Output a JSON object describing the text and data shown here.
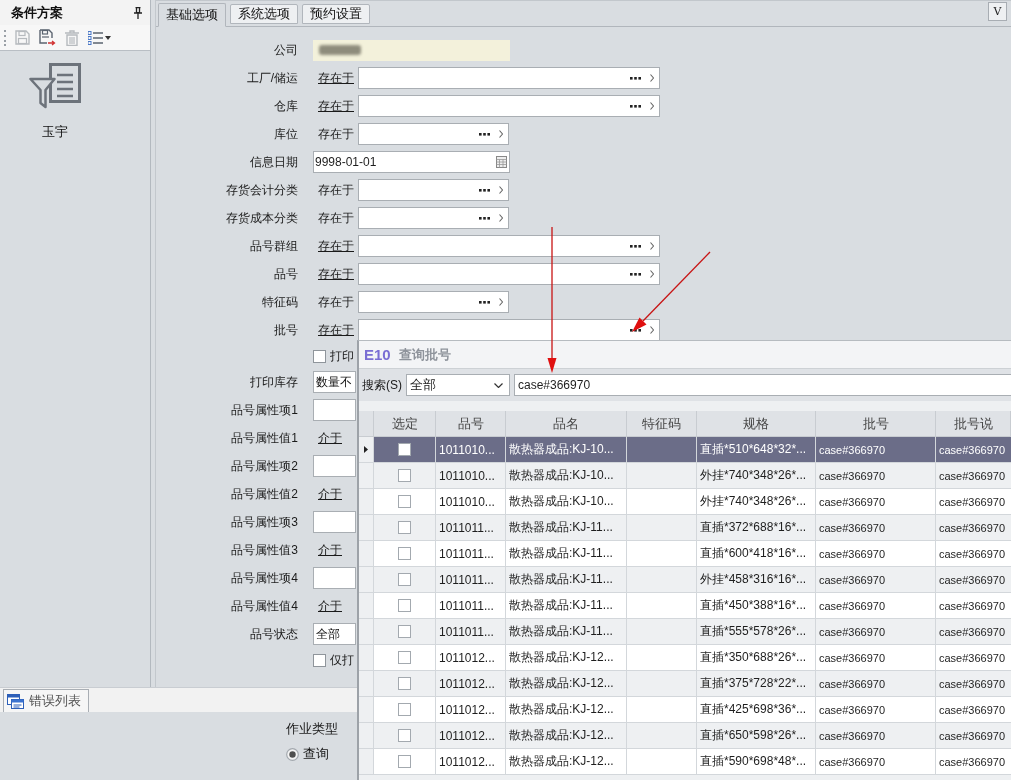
{
  "scheme_panel": {
    "title": "条件方案",
    "toolbar": [
      {
        "kind": "save",
        "disabled": true
      },
      {
        "kind": "save_as",
        "disabled": false
      },
      {
        "kind": "delete",
        "disabled": true
      },
      {
        "kind": "list_menu",
        "disabled": false
      }
    ],
    "schemes": [
      {
        "name": "玉宇"
      }
    ]
  },
  "tabs": [
    {
      "label": "基础选项",
      "selected": true
    },
    {
      "label": "系统选项",
      "selected": false
    },
    {
      "label": "预约设置",
      "selected": false
    }
  ],
  "corner_button": {
    "label": "V"
  },
  "form": {
    "rows": [
      {
        "kind": "redacted",
        "label": "公司"
      },
      {
        "kind": "lookup",
        "label": "工厂/储运",
        "operator": "存在于",
        "underlined": true,
        "wide": true
      },
      {
        "kind": "lookup",
        "label": "仓库",
        "operator": "存在于",
        "underlined": true,
        "wide": true
      },
      {
        "kind": "lookup",
        "label": "库位",
        "operator": "存在于",
        "underlined": false,
        "wide": false
      },
      {
        "kind": "date",
        "label": "信息日期",
        "value": "9998-01-01"
      },
      {
        "kind": "lookup",
        "label": "存货会计分类",
        "operator": "存在于",
        "underlined": false,
        "wide": false
      },
      {
        "kind": "lookup",
        "label": "存货成本分类",
        "operator": "存在于",
        "underlined": false,
        "wide": false
      },
      {
        "kind": "lookup",
        "label": "品号群组",
        "operator": "存在于",
        "underlined": true,
        "wide": true
      },
      {
        "kind": "lookup",
        "label": "品号",
        "operator": "存在于",
        "underlined": true,
        "wide": true
      },
      {
        "kind": "lookup",
        "label": "特征码",
        "operator": "存在于",
        "underlined": false,
        "wide": false
      },
      {
        "kind": "lookup",
        "label": "批号",
        "operator": "存在于",
        "underlined": true,
        "wide": true
      },
      {
        "kind": "checkbox",
        "text": "打印",
        "checked": false
      },
      {
        "kind": "select",
        "label": "打印库存",
        "value": "数量不"
      },
      {
        "kind": "input",
        "label": "品号属性项1"
      },
      {
        "kind": "operator",
        "label": "品号属性值1",
        "operator": "介于",
        "underlined": true
      },
      {
        "kind": "input",
        "label": "品号属性项2"
      },
      {
        "kind": "operator",
        "label": "品号属性值2",
        "operator": "介于",
        "underlined": true
      },
      {
        "kind": "input",
        "label": "品号属性项3"
      },
      {
        "kind": "operator",
        "label": "品号属性值3",
        "operator": "介于",
        "underlined": true
      },
      {
        "kind": "input",
        "label": "品号属性项4"
      },
      {
        "kind": "operator",
        "label": "品号属性值4",
        "operator": "介于",
        "underlined": true
      },
      {
        "kind": "select",
        "label": "品号状态",
        "value": "全部"
      },
      {
        "kind": "checkbox",
        "text": "仅打",
        "checked": false
      }
    ]
  },
  "error_tab": {
    "label": "错误列表"
  },
  "job_type": {
    "label": "作业类型",
    "options": [
      {
        "label": "查询",
        "selected": true
      }
    ]
  },
  "lookup_dialog": {
    "logo": "E10",
    "title": "查询批号",
    "search": {
      "label": "搜索(S)",
      "scope": "全部",
      "value": "case#366970"
    },
    "table": {
      "columns": [
        "选定",
        "品号",
        "品名",
        "特征码",
        "规格",
        "批号",
        "批号说"
      ],
      "rows": [
        {
          "selected": true,
          "checked": false,
          "item_no": "1011010...",
          "item_name": "散热器成品:KJ-10...",
          "spec": "直插*510*648*32*...",
          "batch": "case#366970",
          "batch_note": "case#366970"
        },
        {
          "selected": false,
          "checked": false,
          "item_no": "1011010...",
          "item_name": "散热器成品:KJ-10...",
          "spec": "外挂*740*348*26*...",
          "batch": "case#366970",
          "batch_note": "case#366970"
        },
        {
          "selected": false,
          "checked": false,
          "item_no": "1011010...",
          "item_name": "散热器成品:KJ-10...",
          "spec": "外挂*740*348*26*...",
          "batch": "case#366970",
          "batch_note": "case#366970"
        },
        {
          "selected": false,
          "checked": false,
          "item_no": "1011011...",
          "item_name": "散热器成品:KJ-11...",
          "spec": "直插*372*688*16*...",
          "batch": "case#366970",
          "batch_note": "case#366970"
        },
        {
          "selected": false,
          "checked": false,
          "item_no": "1011011...",
          "item_name": "散热器成品:KJ-11...",
          "spec": "直插*600*418*16*...",
          "batch": "case#366970",
          "batch_note": "case#366970"
        },
        {
          "selected": false,
          "checked": false,
          "item_no": "1011011...",
          "item_name": "散热器成品:KJ-11...",
          "spec": "外挂*458*316*16*...",
          "batch": "case#366970",
          "batch_note": "case#366970"
        },
        {
          "selected": false,
          "checked": false,
          "item_no": "1011011...",
          "item_name": "散热器成品:KJ-11...",
          "spec": "直插*450*388*16*...",
          "batch": "case#366970",
          "batch_note": "case#366970"
        },
        {
          "selected": false,
          "checked": false,
          "item_no": "1011011...",
          "item_name": "散热器成品:KJ-11...",
          "spec": "直插*555*578*26*...",
          "batch": "case#366970",
          "batch_note": "case#366970"
        },
        {
          "selected": false,
          "checked": false,
          "item_no": "1011012...",
          "item_name": "散热器成品:KJ-12...",
          "spec": "直插*350*688*26*...",
          "batch": "case#366970",
          "batch_note": "case#366970"
        },
        {
          "selected": false,
          "checked": false,
          "item_no": "1011012...",
          "item_name": "散热器成品:KJ-12...",
          "spec": "直插*375*728*22*...",
          "batch": "case#366970",
          "batch_note": "case#366970"
        },
        {
          "selected": false,
          "checked": false,
          "item_no": "1011012...",
          "item_name": "散热器成品:KJ-12...",
          "spec": "直插*425*698*36*...",
          "batch": "case#366970",
          "batch_note": "case#366970"
        },
        {
          "selected": false,
          "checked": false,
          "item_no": "1011012...",
          "item_name": "散热器成品:KJ-12...",
          "spec": "直插*650*598*26*...",
          "batch": "case#366970",
          "batch_note": "case#366970"
        },
        {
          "selected": false,
          "checked": false,
          "item_no": "1011012...",
          "item_name": "散热器成品:KJ-12...",
          "spec": "直插*590*698*48*...",
          "batch": "case#366970",
          "batch_note": "case#366970"
        }
      ]
    }
  }
}
